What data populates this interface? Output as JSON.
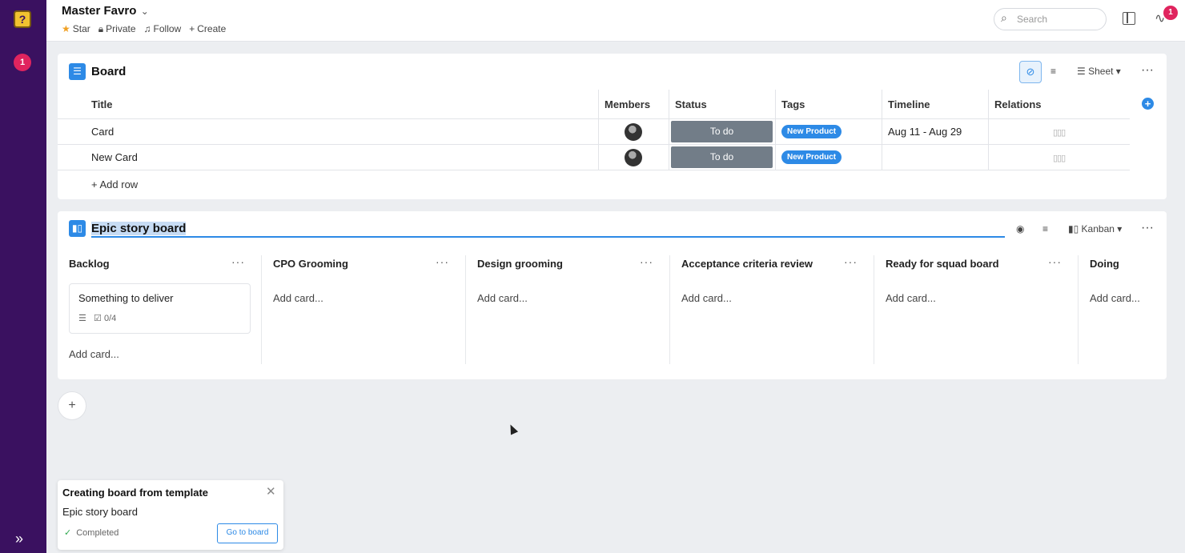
{
  "rail": {
    "logo": "?",
    "badge": "1",
    "expand": "»"
  },
  "header": {
    "title": "Master Favro",
    "actions": {
      "star": "Star",
      "private": "Private",
      "follow": "Follow",
      "create": "Create"
    },
    "search_placeholder": "Search",
    "activity_badge": "1"
  },
  "board1": {
    "name": "Board",
    "view_label": "Sheet",
    "columns": [
      "Title",
      "Members",
      "Status",
      "Tags",
      "Timeline",
      "Relations"
    ],
    "rows": [
      {
        "title": "Card",
        "status": "To do",
        "tag": "New Product",
        "timeline": "Aug 11 - Aug 29"
      },
      {
        "title": "New Card",
        "status": "To do",
        "tag": "New Product",
        "timeline": ""
      }
    ],
    "add_row": "Add row"
  },
  "board2": {
    "name": "Epic story board",
    "view_label": "Kanban",
    "columns": [
      {
        "name": "Backlog",
        "add": "Add card..."
      },
      {
        "name": "CPO Grooming",
        "add": "Add card..."
      },
      {
        "name": "Design grooming",
        "add": "Add card..."
      },
      {
        "name": "Acceptance criteria review",
        "add": "Add card..."
      },
      {
        "name": "Ready for squad board",
        "add": "Add card..."
      },
      {
        "name": "Doing",
        "add": "Add card..."
      }
    ],
    "card": {
      "title": "Something to deliver",
      "checklist": "0/4"
    }
  },
  "toast": {
    "title": "Creating board from template",
    "subtitle": "Epic story board",
    "status": "Completed",
    "button": "Go to board"
  },
  "colors": {
    "accent": "#2d8ae6",
    "rail": "#3a1160",
    "status": "#727d88",
    "badge": "#e0245e"
  }
}
